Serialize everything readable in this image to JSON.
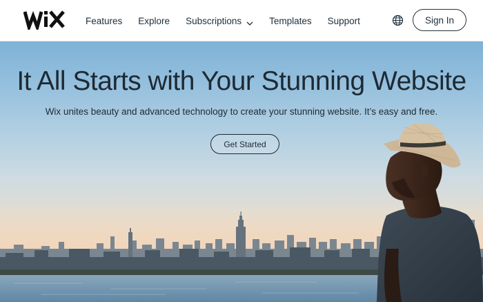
{
  "brand": {
    "logo_text": "WIX"
  },
  "nav": {
    "items": [
      {
        "label": "Features"
      },
      {
        "label": "Explore"
      },
      {
        "label": "Subscriptions",
        "has_dropdown": true
      },
      {
        "label": "Templates"
      },
      {
        "label": "Support"
      }
    ],
    "language_icon": "globe-icon",
    "signin_label": "Sign In"
  },
  "hero": {
    "title": "It All Starts with Your Stunning Website",
    "subtitle": "Wix unites beauty and advanced technology to create your stunning website. It’s easy and free.",
    "cta_label": "Get Started",
    "background_image": "city-skyline-with-man-in-straw-hat"
  },
  "colors": {
    "text_dark": "#20303c",
    "sky_top": "#7fb2d6",
    "horizon": "#efd7bf",
    "water": "#6e8ea6"
  }
}
